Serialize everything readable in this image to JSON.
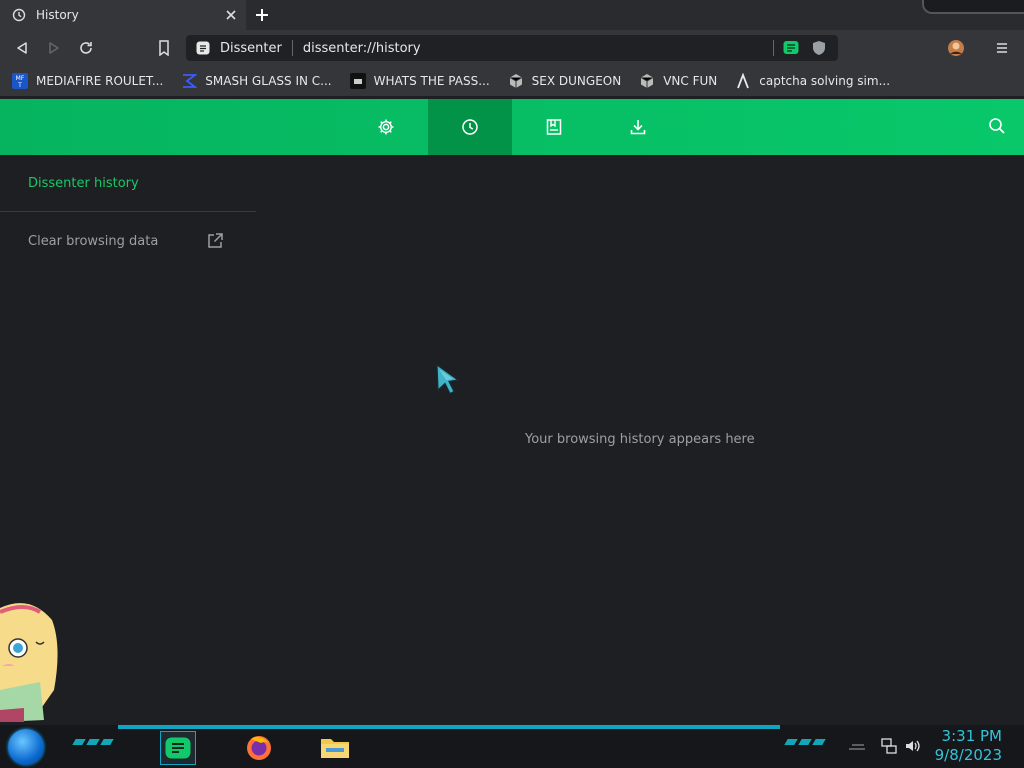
{
  "tab": {
    "title": "History",
    "icon": "history-icon"
  },
  "toolbar": {
    "site_name": "Dissenter",
    "url": "dissenter://history"
  },
  "bookmarks": [
    {
      "label": "MEDIAFIRE ROULET...",
      "icon": "mediafire-icon"
    },
    {
      "label": "SMASH GLASS IN C...",
      "icon": "sigma-icon"
    },
    {
      "label": "WHATS THE PASS...",
      "icon": "site-icon"
    },
    {
      "label": "SEX DUNGEON",
      "icon": "cube-icon"
    },
    {
      "label": "VNC FUN",
      "icon": "cube-icon"
    },
    {
      "label": "captcha solving sim...",
      "icon": "lambda-icon"
    }
  ],
  "header": {
    "nav": [
      "settings-icon",
      "history-icon",
      "bookmarks-icon",
      "downloads-icon"
    ],
    "active": "history-icon",
    "accent": "#06b45f"
  },
  "sidebar": {
    "title": "Dissenter history",
    "clear_label": "Clear browsing data"
  },
  "main": {
    "empty_message": "Your browsing history appears here"
  },
  "taskbar": {
    "time": "3:31 PM",
    "date": "9/8/2023",
    "apps": [
      "dissenter-icon",
      "firefox-icon",
      "file-explorer-icon"
    ]
  }
}
